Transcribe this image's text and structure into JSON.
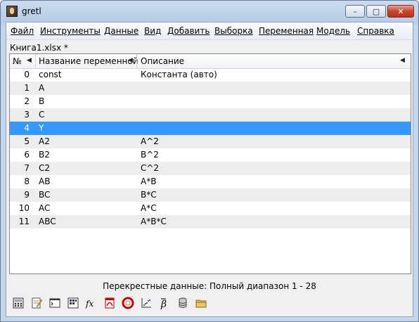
{
  "window": {
    "title": "gretl"
  },
  "titlebar": {
    "minimize": "–",
    "maximize": "▢",
    "close": "✕"
  },
  "menu": [
    "Файл",
    "Инструменты",
    "Данные",
    "Вид",
    "Добавить",
    "Выборка",
    "Переменная",
    "Модель",
    "Справка"
  ],
  "file_label": "Книга1.xlsx *",
  "table": {
    "headers": {
      "no": "№",
      "name": "Название переменной",
      "desc": "Описание"
    },
    "rows": [
      {
        "no": "0",
        "name": "const",
        "desc": "Константа (авто)"
      },
      {
        "no": "1",
        "name": "A",
        "desc": ""
      },
      {
        "no": "2",
        "name": "B",
        "desc": ""
      },
      {
        "no": "3",
        "name": "C",
        "desc": ""
      },
      {
        "no": "4",
        "name": "Y",
        "desc": ""
      },
      {
        "no": "5",
        "name": "A2",
        "desc": "A^2"
      },
      {
        "no": "6",
        "name": "B2",
        "desc": "B^2"
      },
      {
        "no": "7",
        "name": "C2",
        "desc": "C^2"
      },
      {
        "no": "8",
        "name": "AB",
        "desc": "A*B"
      },
      {
        "no": "9",
        "name": "BC",
        "desc": "B*C"
      },
      {
        "no": "10",
        "name": "AC",
        "desc": "A*C"
      },
      {
        "no": "11",
        "name": "ABC",
        "desc": "A*B*C"
      }
    ],
    "selected_index": 4
  },
  "status": "Перекрестные данные: Полный диапазон 1 - 28",
  "toolbar_icons": [
    "calculator-icon",
    "notepad-icon",
    "terminal-icon",
    "session-icon",
    "function-icon",
    "pdf-icon",
    "help-icon",
    "scatter-icon",
    "beta-icon",
    "database-icon",
    "folder-icon"
  ],
  "colors": {
    "selection": "#3399ff",
    "window_frame": "#b7cde6"
  }
}
